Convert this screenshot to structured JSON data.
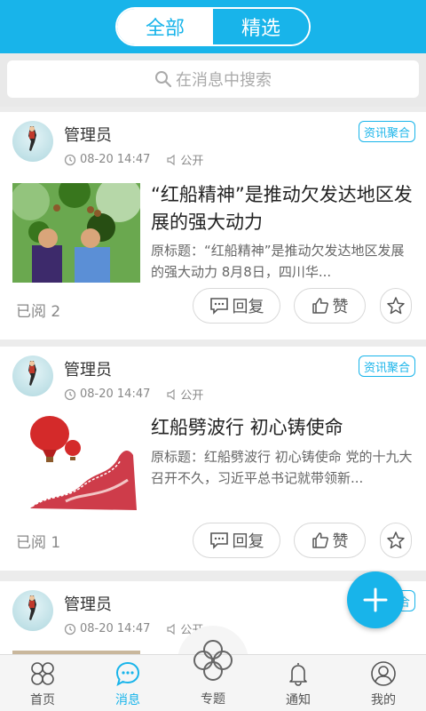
{
  "header": {
    "tabs": [
      {
        "label": "全部",
        "active": true
      },
      {
        "label": "精选",
        "active": false
      }
    ],
    "accent_color": "#18b4ea"
  },
  "search": {
    "placeholder": "在消息中搜索",
    "icon": "search-icon"
  },
  "posts": [
    {
      "author": "管理员",
      "time": "08-20 14:47",
      "visibility": "公开",
      "badge": "资讯聚合",
      "title": "“红船精神”是推动欠发达地区发展的强大动力",
      "summary": "原标题：“红船精神”是推动欠发达地区发展的强大动力 8月8日，四川华...",
      "reads": "已阅 2",
      "reply_label": "回复",
      "like_label": "赞"
    },
    {
      "author": "管理员",
      "time": "08-20 14:47",
      "visibility": "公开",
      "badge": "资讯聚合",
      "title": "红船劈波行 初心铸使命",
      "summary": "原标题：红船劈波行 初心铸使命 党的十九大召开不久，习近平总书记就带领新...",
      "reads": "已阅 1",
      "reply_label": "回复",
      "like_label": "赞"
    },
    {
      "author": "管理员",
      "time": "08-20 14:47",
      "visibility": "公开",
      "badge": "资讯聚合"
    }
  ],
  "nav": [
    {
      "label": "首页",
      "icon": "home-grid-icon",
      "active": false
    },
    {
      "label": "消息",
      "icon": "message-icon",
      "active": true
    },
    {
      "label": "专题",
      "icon": "topic-swirl-icon",
      "active": false
    },
    {
      "label": "通知",
      "icon": "bell-icon",
      "active": false
    },
    {
      "label": "我的",
      "icon": "user-icon",
      "active": false
    }
  ],
  "fab": {
    "icon": "plus-icon"
  }
}
